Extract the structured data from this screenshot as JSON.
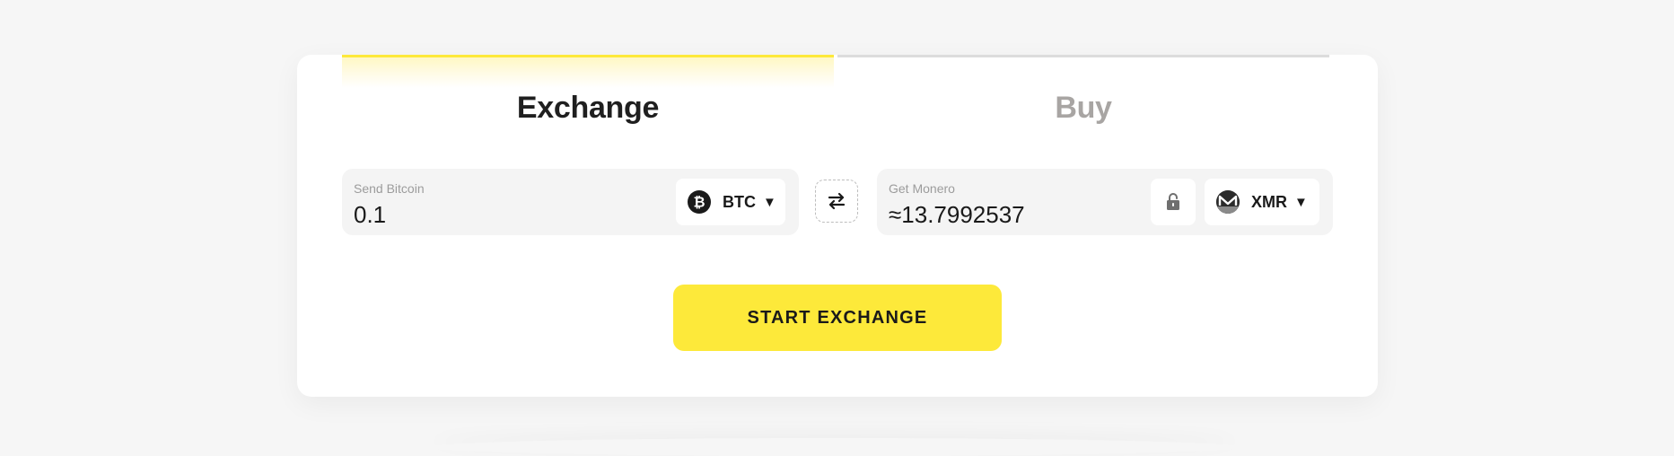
{
  "tabs": {
    "exchange_label": "Exchange",
    "buy_label": "Buy",
    "active": "Exchange"
  },
  "send": {
    "label": "Send Bitcoin",
    "amount": "0.1",
    "currency": "BTC",
    "icon": "bitcoin-icon"
  },
  "get": {
    "label": "Get Monero",
    "amount": "≈13.7992537",
    "currency": "XMR",
    "icon": "monero-icon",
    "lock_icon": "unlock-icon"
  },
  "swap_icon": "swap-arrows-icon",
  "caret": "▼",
  "start_button_label": "START EXCHANGE",
  "colors": {
    "accent": "#fde93a",
    "background": "#f6f6f6",
    "field_background": "#f4f4f4",
    "inactive_tab_text": "#a8a5a3",
    "text": "#1a1a1a"
  }
}
